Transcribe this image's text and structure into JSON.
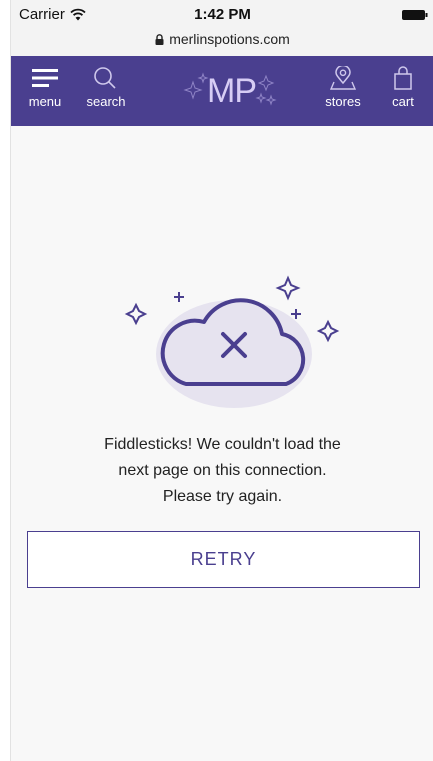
{
  "status_bar": {
    "carrier": "Carrier",
    "time": "1:42 PM",
    "url": "merlinspotions.com"
  },
  "navbar": {
    "menu_label": "menu",
    "search_label": "search",
    "logo_text": "MP",
    "stores_label": "stores",
    "cart_label": "cart",
    "background_color": "#4a3f8f"
  },
  "error": {
    "line1": "Fiddlesticks! We couldn't load the",
    "line2": "next page on this connection.",
    "line3": "Please try again.",
    "icon": "cloud-error-icon"
  },
  "retry_button": {
    "label": "RETRY"
  },
  "colors": {
    "accent": "#4a3f8f",
    "cloud_fill": "#e6e3ef",
    "background": "#f8f8f8"
  }
}
